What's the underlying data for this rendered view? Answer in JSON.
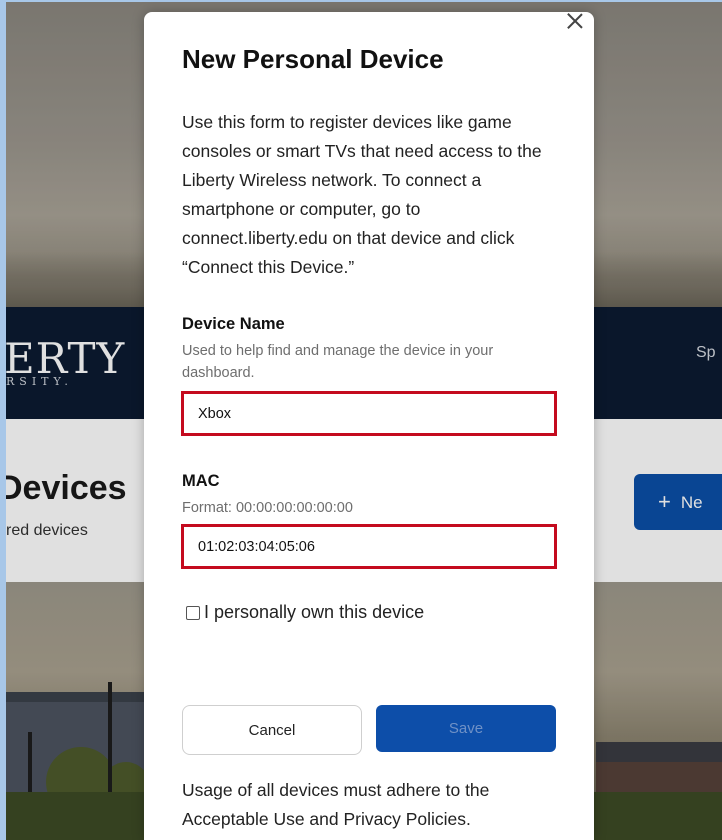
{
  "background": {
    "logo_text": "ERTY",
    "logo_sub": "RSITY.",
    "nav_link": "Sp",
    "page_heading": "Devices",
    "page_subtitle": "red devices",
    "new_button_icon": "plus-icon",
    "new_button_label": "Ne"
  },
  "modal": {
    "title": "New Personal Device",
    "close_icon": "close-icon",
    "intro": "Use this form to register devices like game consoles or smart TVs that need access to the Liberty Wireless network. To connect a smartphone or computer, go to connect.liberty.edu on that device and click “Connect this Device.”",
    "device_name": {
      "label": "Device Name",
      "helper": "Used to help find and manage the device in your dashboard.",
      "value": "Xbox"
    },
    "mac": {
      "label": "MAC",
      "helper": "Format: 00:00:00:00:00:00",
      "value": "01:02:03:04:05:06"
    },
    "ownership_checkbox": {
      "label": "I personally own this device",
      "checked": false
    },
    "cancel_label": "Cancel",
    "save_label": "Save",
    "footer_note": "Usage of all devices must adhere to the Acceptable Use and Privacy Policies."
  },
  "colors": {
    "navbar": "#0c1b31",
    "primary_button": "#0d4ea9",
    "highlight_border": "#c40a1e"
  }
}
